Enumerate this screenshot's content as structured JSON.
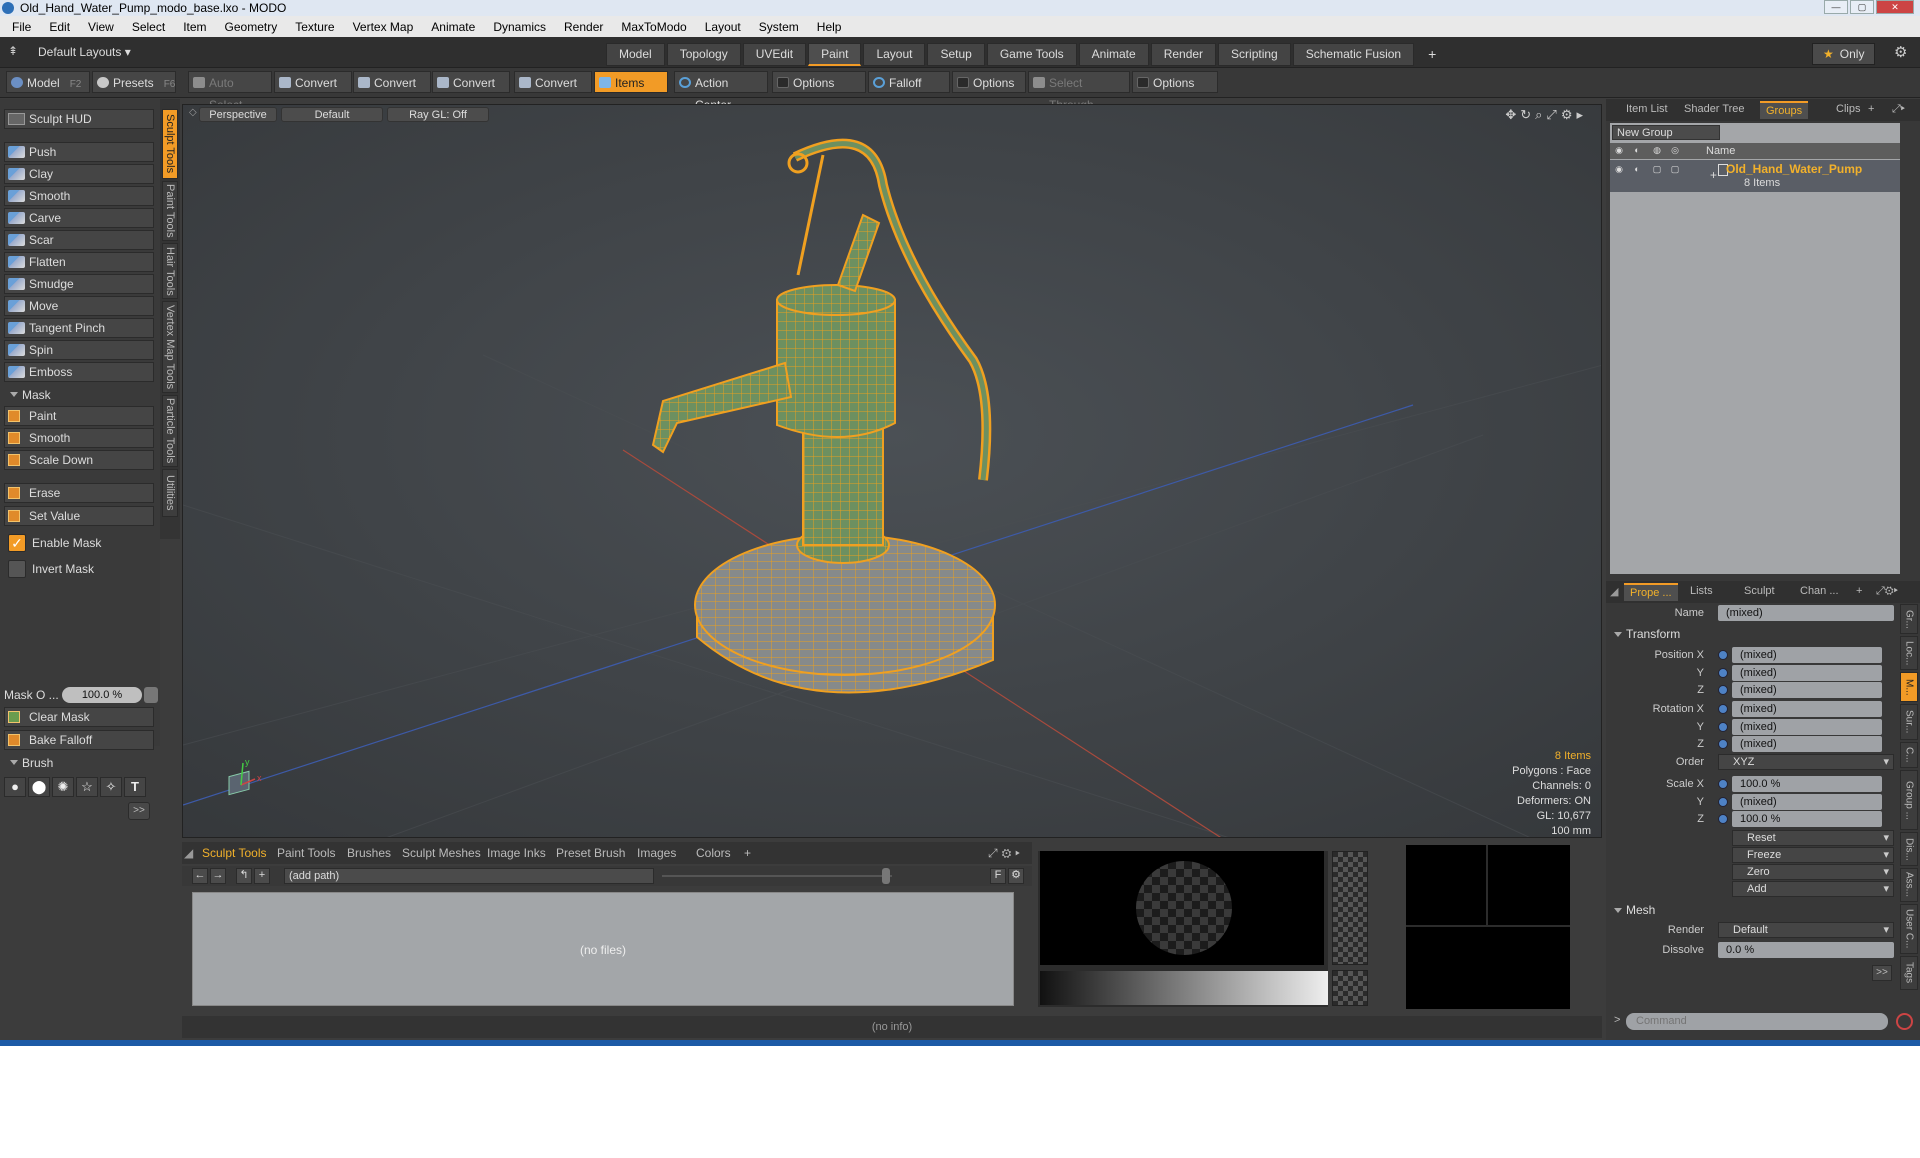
{
  "window": {
    "title": "Old_Hand_Water_Pump_modo_base.lxo - MODO"
  },
  "menu": [
    "File",
    "Edit",
    "View",
    "Select",
    "Item",
    "Geometry",
    "Texture",
    "Vertex Map",
    "Animate",
    "Dynamics",
    "Render",
    "MaxToModo",
    "Layout",
    "System",
    "Help"
  ],
  "layoutbar": {
    "layouts_label": "Default Layouts ▾",
    "tabs": [
      "Model",
      "Topology",
      "UVEdit",
      "Paint",
      "Layout",
      "Setup",
      "Game Tools",
      "Animate",
      "Render",
      "Scripting",
      "Schematic Fusion"
    ],
    "active_tab": "Paint",
    "add_tab": "+",
    "only_label": "Only"
  },
  "toolbar": {
    "model": "Model",
    "model_key": "F2",
    "presets": "Presets",
    "presets_key": "F6",
    "auto_select": "Auto Select",
    "convert": "Convert",
    "items": "Items",
    "action_center": "Action Center",
    "options": "Options",
    "falloff": "Falloff",
    "select_through": "Select Through"
  },
  "left": {
    "sculpt_hud": "Sculpt HUD",
    "tools": [
      "Push",
      "Clay",
      "Smooth",
      "Carve",
      "Scar",
      "Flatten",
      "Smudge",
      "Move",
      "Tangent Pinch",
      "Spin",
      "Emboss"
    ],
    "mask_header": "Mask",
    "mask_tools": [
      "Paint",
      "Smooth",
      "Scale Down"
    ],
    "erase": "Erase",
    "set_value": "Set Value",
    "enable_mask": "Enable Mask",
    "invert_mask": "Invert Mask",
    "mask_opacity_label": "Mask O ...",
    "mask_opacity_value": "100.0 %",
    "clear_mask": "Clear Mask",
    "bake_falloff": "Bake Falloff",
    "brush_header": "Brush",
    "more": ">>"
  },
  "vtabs": [
    "Sculpt Tools",
    "Paint Tools",
    "Hair Tools",
    "Vertex Map Tools",
    "Particle Tools",
    "Utilities"
  ],
  "viewport": {
    "perspective": "Perspective",
    "default": "Default",
    "raygl": "Ray GL: Off",
    "stats": {
      "items": "8 Items",
      "polygons": "Polygons : Face",
      "channels": "Channels: 0",
      "deformers": "Deformers: ON",
      "gl": "GL: 10,677",
      "scale": "100 mm"
    }
  },
  "bottom": {
    "tabs": [
      "Sculpt Tools",
      "Paint Tools",
      "Brushes",
      "Sculpt Meshes",
      "Image Inks",
      "Preset Brush",
      "Images",
      "Colors"
    ],
    "add_tab": "+",
    "path": "(add path)",
    "f_btn": "F",
    "no_files": "(no files)",
    "info": "(no info)"
  },
  "right": {
    "top_tabs": [
      "Item List",
      "Shader Tree",
      "Groups",
      "Clips"
    ],
    "active_top": "Groups",
    "new_group": "New Group",
    "name_header": "Name",
    "group_name": "Old_Hand_Water_Pump",
    "group_count": "8 Items",
    "prop_tabs": [
      "Prope ...",
      "Lists",
      "Sculpt",
      "Chan ..."
    ],
    "name_label": "Name",
    "name_value": "(mixed)",
    "transform": "Transform",
    "position_x_label": "Position X",
    "position_x": "(mixed)",
    "y_label": "Y",
    "z_label": "Z",
    "position_y": "(mixed)",
    "position_z": "(mixed)",
    "rotation_x_label": "Rotation X",
    "rotation_x": "(mixed)",
    "rotation_y": "(mixed)",
    "rotation_z": "(mixed)",
    "order_label": "Order",
    "order_value": "XYZ",
    "scale_x_label": "Scale X",
    "scale_x": "100.0 %",
    "scale_y": "(mixed)",
    "scale_z": "100.0 %",
    "reset": "Reset",
    "freeze": "Freeze",
    "zero": "Zero",
    "add": "Add",
    "mesh": "Mesh",
    "render_label": "Render",
    "render_value": "Default",
    "dissolve_label": "Dissolve",
    "dissolve_value": "0.0 %",
    "more": ">>",
    "side_tabs": [
      "Gr...",
      "Loc...",
      "M...",
      "Sur...",
      "C...",
      "Group ...",
      "Dis...",
      "Ass...",
      "User C...",
      "Tags"
    ],
    "command_prompt": ">",
    "command_placeholder": "Command"
  },
  "colors": {
    "accent": "#f29b26",
    "mesh_wire": "#f0a020",
    "mesh_fill": "#5f8c57",
    "background": "#3c3c3c"
  }
}
